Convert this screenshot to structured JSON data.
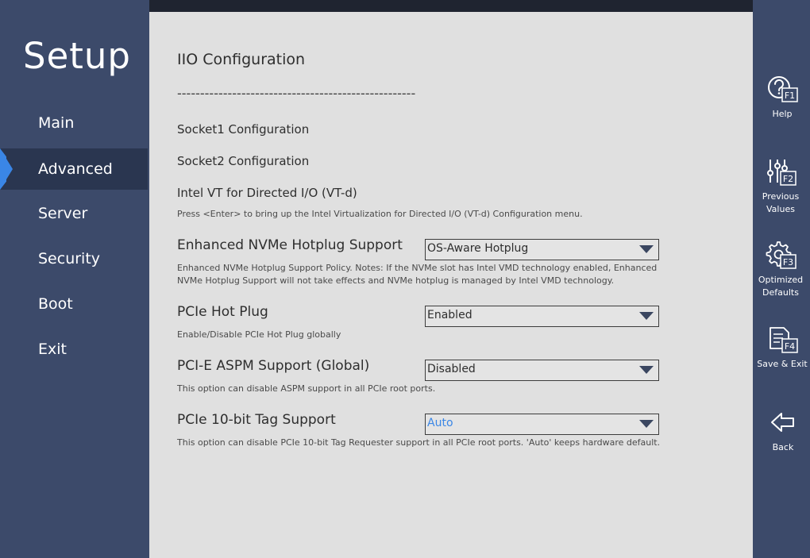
{
  "sidebar": {
    "title": "Setup",
    "items": [
      {
        "label": "Main"
      },
      {
        "label": "Advanced"
      },
      {
        "label": "Server"
      },
      {
        "label": "Security"
      },
      {
        "label": "Boot"
      },
      {
        "label": "Exit"
      }
    ],
    "active": "Advanced"
  },
  "main": {
    "title": "IIO Configuration",
    "divider": "----------------------------------------------------",
    "links": [
      {
        "label": "Socket1 Configuration"
      },
      {
        "label": "Socket2 Configuration"
      },
      {
        "label": "Intel VT for Directed I/O (VT-d)",
        "help": "Press <Enter> to bring up the Intel Virtualization for Directed I/O (VT-d) Configuration menu."
      }
    ],
    "settings": [
      {
        "label": "Enhanced NVMe Hotplug Support",
        "value": "OS-Aware Hotplug",
        "help": "Enhanced NVMe Hotplug Support Policy. Notes: If the NVMe slot has Intel VMD technology enabled, Enhanced NVMe Hotplug Support will not take effects and NVMe hotplug is managed by Intel VMD technology."
      },
      {
        "label": "PCIe Hot Plug",
        "value": "Enabled",
        "help": "Enable/Disable PCIe Hot Plug globally"
      },
      {
        "label": "PCI-E ASPM Support (Global)",
        "value": "Disabled",
        "help": "This option can disable ASPM support in all PCIe root ports."
      },
      {
        "label": "PCIe 10-bit Tag Support",
        "value": "Auto",
        "help": "This option can disable PCIe 10-bit Tag Requester support in all PCIe root ports. 'Auto' keeps hardware default."
      }
    ]
  },
  "toolbar": {
    "help": {
      "label": "Help",
      "key": "F1",
      "icon": "help-icon"
    },
    "previous": {
      "label": "Previous Values",
      "key": "F2",
      "icon": "sliders-icon"
    },
    "optimized": {
      "label": "Optimized Defaults",
      "key": "F3",
      "icon": "gear-icon"
    },
    "save": {
      "label": "Save & Exit",
      "key": "F4",
      "icon": "save-document-icon"
    },
    "back": {
      "label": "Back",
      "icon": "back-arrow-icon"
    }
  },
  "colors": {
    "sidebar_bg": "#3c4a6a",
    "active_bg": "#2a3650",
    "accent": "#3a86e6",
    "main_bg": "#e0e0e0"
  }
}
